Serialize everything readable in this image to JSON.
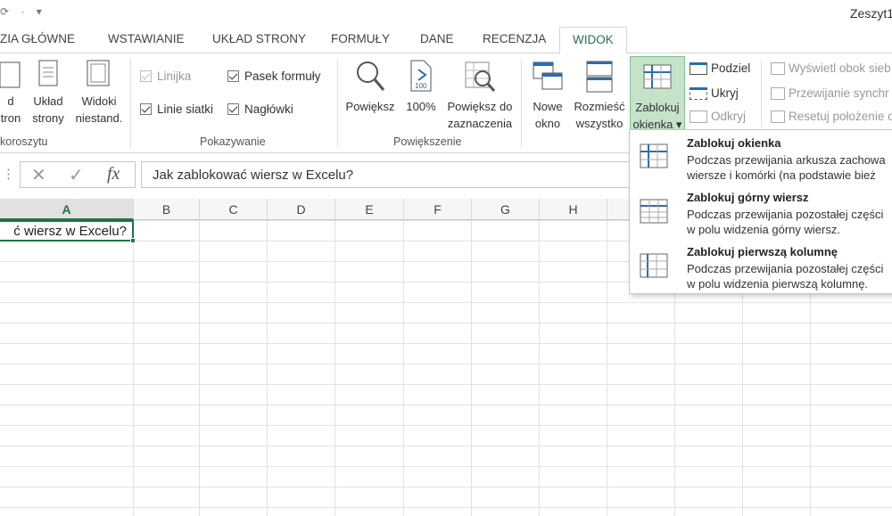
{
  "window": {
    "title": "Zeszyt1"
  },
  "tabs": [
    "ZIA GŁÓWNE",
    "WSTAWIANIE",
    "UKŁAD STRONY",
    "FORMUŁY",
    "DANE",
    "RECENZJA",
    "WIDOK"
  ],
  "active_tab": "WIDOK",
  "ribbon": {
    "views": {
      "btn_normal": [
        "d",
        "tron"
      ],
      "btn_layout": [
        "Układ",
        "strony"
      ],
      "btn_custom": [
        "Widoki",
        "niestand."
      ],
      "label": "koroszytu"
    },
    "show": {
      "ruler": "Linijka",
      "gridlines": "Linie siatki",
      "formula_bar": "Pasek formuły",
      "headings": "Nagłówki",
      "label": "Pokazywanie"
    },
    "zoom": {
      "zoom": "Powiększ",
      "zoom100": "100%",
      "zoom_sel": [
        "Powiększ do",
        "zaznaczenia"
      ],
      "label": "Powiększenie"
    },
    "window": {
      "new_window": [
        "Nowe",
        "okno"
      ],
      "arrange": [
        "Rozmieść",
        "wszystko"
      ],
      "freeze": [
        "Zablokuj",
        "okienka ▾"
      ],
      "split": "Podziel",
      "hide": "Ukryj",
      "unhide": "Odkryj",
      "side_by_side": "Wyświetl obok sieb",
      "sync_scroll": "Przewijanie synchr",
      "reset_pos": "Resetuj położenie o"
    }
  },
  "formula_bar": {
    "cancel": "✕",
    "enter": "✓",
    "fx": "fx",
    "value": "Jak zablokować wiersz w Excelu?"
  },
  "columns": [
    "A",
    "B",
    "C",
    "D",
    "E",
    "F",
    "G",
    "H"
  ],
  "cell_a1": "ć wiersz w Excelu?",
  "freeze_menu": {
    "items": [
      {
        "title": "Zablokuj okienka",
        "desc": [
          "Podczas przewijania arkusza zachowa",
          "wiersze i komórki (na podstawie bież"
        ]
      },
      {
        "title": "Zablokuj górny wiersz",
        "desc": [
          "Podczas przewijania pozostałej części",
          "w polu widzenia górny wiersz."
        ]
      },
      {
        "title": "Zablokuj pierwszą kolumnę",
        "desc": [
          "Podczas przewijania pozostałej części",
          "w polu widzenia pierwszą kolumnę."
        ]
      }
    ]
  },
  "colors": {
    "accent": "#217346",
    "active_button_bg": "#c5e3c9"
  }
}
